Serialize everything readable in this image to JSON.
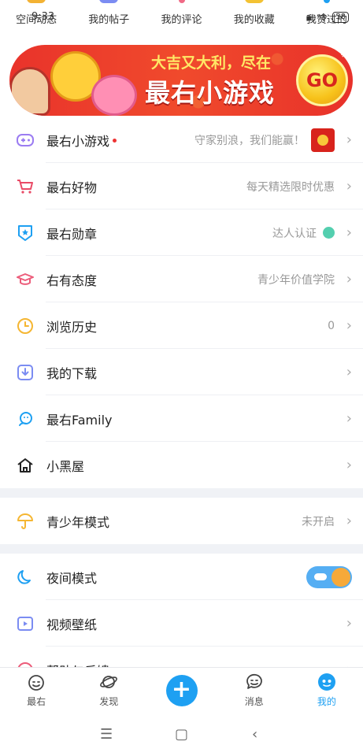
{
  "status": {
    "time": "9:33",
    "network": "令",
    "battery": "58"
  },
  "quick_tabs": [
    {
      "label": "空间动态",
      "color": "#f3b233"
    },
    {
      "label": "我的帖子",
      "color": "#7b8cf2"
    },
    {
      "label": "我的评论",
      "color": "#f06a86"
    },
    {
      "label": "我的收藏",
      "color": "#f3c233"
    },
    {
      "label": "我赞过的",
      "color": "#1ea0f2"
    }
  ],
  "banner": {
    "line1": "大吉又大利，尽在",
    "line2": "最右小游戏",
    "button": "GO"
  },
  "menu": [
    {
      "label": "最右小游戏",
      "sub": "守家别浪，我们能赢！",
      "icon": "gamepad-icon",
      "dot": true
    },
    {
      "label": "最右好物",
      "sub": "每天精选限时优惠",
      "icon": "cart-icon"
    },
    {
      "label": "最右勋章",
      "sub": "达人认证",
      "icon": "medal-icon"
    },
    {
      "label": "右有态度",
      "sub": "青少年价值学院",
      "icon": "graduation-cap-icon"
    },
    {
      "label": "浏览历史",
      "sub": "0",
      "icon": "clock-icon"
    },
    {
      "label": "我的下载",
      "sub": "",
      "icon": "download-icon"
    },
    {
      "label": "最右Family",
      "sub": "",
      "icon": "family-icon"
    },
    {
      "label": "小黑屋",
      "sub": "",
      "icon": "house-icon"
    }
  ],
  "youth": {
    "label": "青少年模式",
    "sub": "未开启"
  },
  "settings": [
    {
      "label": "夜间模式",
      "toggle": true
    },
    {
      "label": "视频壁纸"
    },
    {
      "label": "帮助与反馈"
    }
  ],
  "bottom_nav": [
    {
      "label": "最右",
      "icon": "face-icon"
    },
    {
      "label": "发现",
      "icon": "planet-icon"
    },
    {
      "label": "",
      "icon": "plus-icon"
    },
    {
      "label": "消息",
      "icon": "message-icon"
    },
    {
      "label": "我的",
      "icon": "profile-icon",
      "active": true
    }
  ],
  "colors": {
    "accent": "#1ea0f2",
    "divider": "#eef0f3",
    "section_gap": "#f0f2f6"
  }
}
